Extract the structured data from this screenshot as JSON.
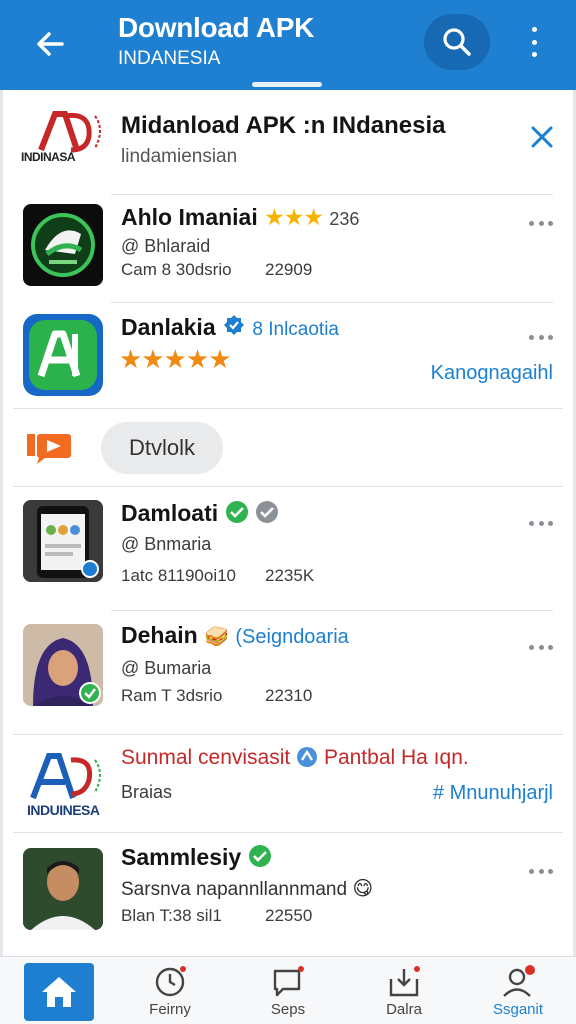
{
  "appbar": {
    "title": "Download APK",
    "subtitle": "INDANESIA"
  },
  "banner": {
    "logo_text": "INDINASA",
    "title": "Midanload APK :n INdanesia",
    "subtitle": "lindamiensian"
  },
  "items": [
    {
      "name": "Ahlo Imaniai",
      "rating_text": "236",
      "handle": "@ Bhlaraid",
      "meta": "Cam 8 30dsrio",
      "count": "22909"
    },
    {
      "name": "Danlakia",
      "tag": "8 Inlcaotia",
      "action": "Kanognagaihl"
    },
    {
      "name": "Damloati",
      "handle": "@ Bnmaria",
      "meta": "1atc 81190oi10",
      "count": "2235K"
    },
    {
      "name": "Dehain",
      "tag": "(Seigndoaria",
      "handle": "@ Bumaria",
      "meta": "Ram T 3dsrio",
      "count": "22310"
    },
    {
      "name": "Sammlesiy",
      "handle": "Sarsnva napannllannmand",
      "meta": "Blan T:38 sil1",
      "count": "22550"
    }
  ],
  "promo": {
    "button_label": "Dtvlolk"
  },
  "sponsored": {
    "logo_text": "INDUINESA",
    "headline": "Sunmal cenvisasit",
    "headline_tag": "Pantbal Ha ıqn.",
    "sub": "Braias",
    "link": "# Mnunuhjarjl"
  },
  "bottom_nav": [
    {
      "label": "",
      "icon": "home-icon"
    },
    {
      "label": "Feirny",
      "icon": "clock-icon"
    },
    {
      "label": "Seps",
      "icon": "chat-icon"
    },
    {
      "label": "Dalra",
      "icon": "download-box-icon"
    },
    {
      "label": "Ssganit",
      "icon": "profile-icon"
    }
  ],
  "colors": {
    "primary": "#1f7fd0",
    "star": "#f4b400",
    "verified": "#2fb24f",
    "accent_red": "#c62828"
  }
}
